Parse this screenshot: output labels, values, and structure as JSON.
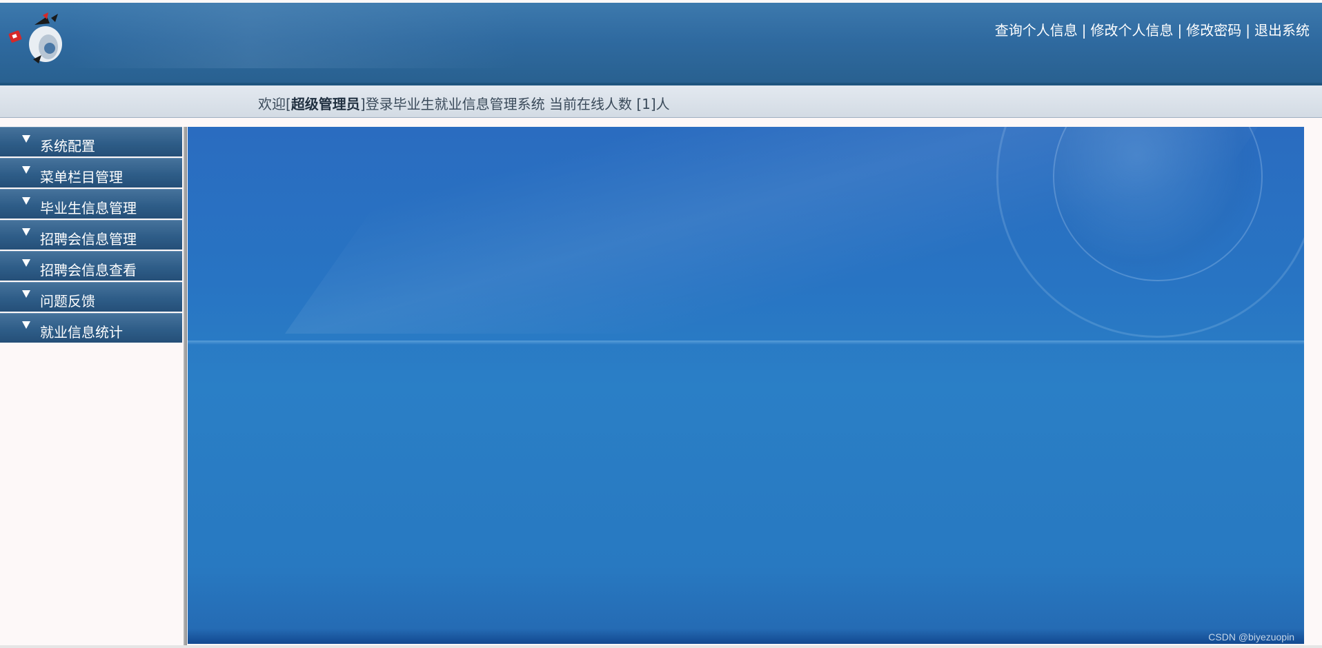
{
  "header": {
    "links": [
      "查询个人信息",
      "修改个人信息",
      "修改密码",
      "退出系统"
    ],
    "separator": "|"
  },
  "welcome": {
    "prefix": "欢迎[",
    "role": "超级管理员",
    "suffix": "]登录毕业生就业信息管理系统 当前在线人数 [1]人"
  },
  "sidebar": {
    "items": [
      {
        "label": "系统配置",
        "icon": "triangle-down-icon"
      },
      {
        "label": "菜单栏目管理",
        "icon": "triangle-down-icon"
      },
      {
        "label": "毕业生信息管理",
        "icon": "triangle-down-icon"
      },
      {
        "label": "招聘会信息管理",
        "icon": "triangle-down-icon"
      },
      {
        "label": "招聘会信息查看",
        "icon": "triangle-down-icon"
      },
      {
        "label": "问题反馈",
        "icon": "triangle-down-icon"
      },
      {
        "label": "就业信息统计",
        "icon": "triangle-down-icon"
      }
    ]
  },
  "main": {
    "watermark": "CSDN @biyezuopin"
  },
  "colors": {
    "header": "#2f6aa0",
    "menu": "#2e5d88",
    "content": "#2874c3",
    "welcome_bar": "#dbe2ea"
  }
}
